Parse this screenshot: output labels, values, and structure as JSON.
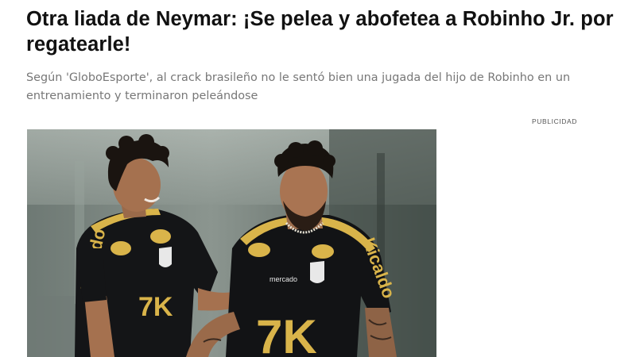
{
  "article": {
    "headline": "Otra liada de Neymar: ¡Se pelea y abofetea a Robinho Jr. por regatearle!",
    "standfirst": "Según 'GloboEsporte', al crack brasileño no le sentó bien una jugada del hijo de Robinho en un entrenamiento y terminaron peleándose",
    "ad_label": "PUBLICIDAD"
  },
  "photo": {
    "jersey_sponsor_sleeve": "Kicaldo",
    "jersey_sponsor_chest": "Canção",
    "jersey_maker": "mercado",
    "jersey_main_sponsor": "7K",
    "colors": {
      "jersey": "#121315",
      "trim": "#d9b44a",
      "background": "#7f8a84"
    }
  }
}
